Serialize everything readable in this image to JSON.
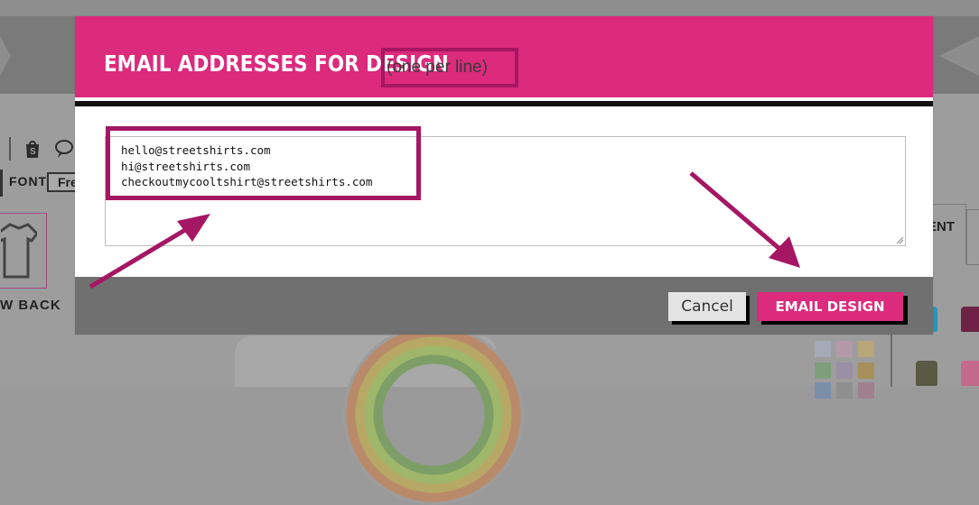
{
  "background": {
    "font_label": "FONT:",
    "font_value": "Fre",
    "view_back_label": "W BACK",
    "right_tab_label": "ENT",
    "toolbar_icons": [
      "shopify-bag-icon",
      "speech-bubble-icon"
    ]
  },
  "modal": {
    "title": "EMAIL ADDRESSES FOR DESIGN",
    "hint": "(one per line)",
    "emails": "hello@streetshirts.com\nhi@streetshirts.com\ncheckoutmycooltshirt@streetshirts.com",
    "cancel_label": "Cancel",
    "submit_label": "EMAIL DESIGN"
  },
  "colors": {
    "brand_pink": "#dc2a7c",
    "annotation": "#a51663",
    "footer_gray": "#707070"
  }
}
